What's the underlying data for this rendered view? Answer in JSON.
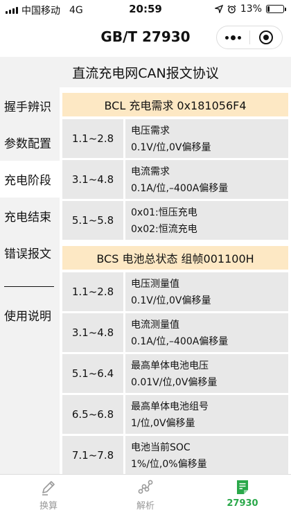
{
  "status": {
    "carrier": "中国移动",
    "network": "4G",
    "time": "20:59",
    "battery": "13%",
    "battery_level": 0.13
  },
  "nav": {
    "title": "GB/T 27930"
  },
  "page": {
    "header": "直流充电网CAN报文协议"
  },
  "sidebar": {
    "items": [
      {
        "label": "握手辨识"
      },
      {
        "label": "参数配置"
      },
      {
        "label": "充电阶段"
      },
      {
        "label": "充电结束"
      },
      {
        "label": "错误报文"
      }
    ],
    "help": "使用说明"
  },
  "sections": [
    {
      "title": "BCL  充电需求  0x181056F4",
      "rows": [
        {
          "range": "1.1~2.8",
          "line1": "电压需求",
          "line2": "0.1V/位,0V偏移量"
        },
        {
          "range": "3.1~4.8",
          "line1": "电流需求",
          "line2": "0.1A/位,–400A偏移量"
        },
        {
          "range": "5.1~5.8",
          "line1": "0x01:恒压充电",
          "line2": "0x02:恒流充电"
        }
      ]
    },
    {
      "title": "BCS  电池总状态  组帧001100H",
      "rows": [
        {
          "range": "1.1~2.8",
          "line1": "电压测量值",
          "line2": "0.1V/位,0V偏移量"
        },
        {
          "range": "3.1~4.8",
          "line1": "电流测量值",
          "line2": "0.1A/位,–400A偏移量"
        },
        {
          "range": "5.1~6.4",
          "line1": "最高单体电池电压",
          "line2": "0.01V/位,0V偏移量"
        },
        {
          "range": "6.5~6.8",
          "line1": "最高单体电池组号",
          "line2": "1/位,0V偏移量"
        },
        {
          "range": "7.1~7.8",
          "line1": "电池当前SOC",
          "line2": "1%/位,0%偏移量"
        }
      ]
    }
  ],
  "tabs": [
    {
      "label": "换算",
      "icon": "pen-icon"
    },
    {
      "label": "解析",
      "icon": "nodes-icon"
    },
    {
      "label": "27930",
      "icon": "document-icon"
    }
  ],
  "colors": {
    "accent_green": "#2aa84a",
    "section_header_bg": "#fde8c4",
    "cell_bg": "#e8e8e8",
    "sidebar_bg": "#f2f2f2"
  }
}
